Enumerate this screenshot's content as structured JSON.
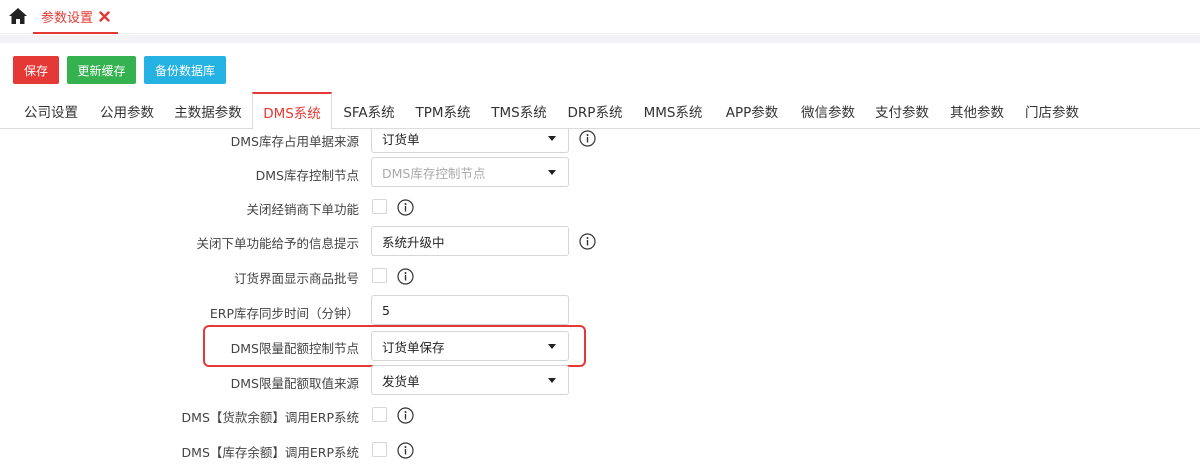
{
  "top": {
    "page_tab_label": "参数设置"
  },
  "toolbar": {
    "save_label": "保存",
    "refresh_cache_label": "更新缓存",
    "backup_db_label": "备份数据库"
  },
  "tabs": [
    {
      "label": "公司设置"
    },
    {
      "label": "公用参数"
    },
    {
      "label": "主数据参数"
    },
    {
      "label": "DMS系统",
      "active": true
    },
    {
      "label": "SFA系统"
    },
    {
      "label": "TPM系统"
    },
    {
      "label": "TMS系统"
    },
    {
      "label": "DRP系统"
    },
    {
      "label": "MMS系统"
    },
    {
      "label": "APP参数"
    },
    {
      "label": "微信参数"
    },
    {
      "label": "支付参数"
    },
    {
      "label": "其他参数"
    },
    {
      "label": "门店参数"
    }
  ],
  "form": {
    "rows": [
      {
        "label": "DMS库存占用单据来源",
        "type": "select",
        "value": "订货单",
        "info": true
      },
      {
        "label": "DMS库存控制节点",
        "type": "select",
        "placeholder": "DMS库存控制节点",
        "info": false
      },
      {
        "label": "关闭经销商下单功能",
        "type": "checkbox",
        "checked": false,
        "info": true
      },
      {
        "label": "关闭下单功能给予的信息提示",
        "type": "text",
        "value": "系统升级中",
        "info": true
      },
      {
        "label": "订货界面显示商品批号",
        "type": "checkbox",
        "checked": false,
        "info": true
      },
      {
        "label": "ERP库存同步时间（分钟）",
        "type": "text",
        "value": "5",
        "info": false
      },
      {
        "label": "DMS限量配额控制节点",
        "type": "select",
        "value": "订货单保存",
        "info": false,
        "highlighted": true
      },
      {
        "label": "DMS限量配额取值来源",
        "type": "select",
        "value": "发货单",
        "info": false
      },
      {
        "label": "DMS【货款余额】调用ERP系统",
        "type": "checkbox",
        "checked": false,
        "info": true
      },
      {
        "label": "DMS【库存余额】调用ERP系统",
        "type": "checkbox",
        "checked": false,
        "info": true
      }
    ]
  },
  "colors": {
    "accent_red": "#e53935",
    "save_red": "#e53935",
    "cache_green": "#34b24f",
    "backup_blue": "#24b2e3"
  },
  "icons": {
    "home": "home-icon",
    "close": "close-icon",
    "info": "info-icon",
    "caret": "caret-down-icon"
  }
}
